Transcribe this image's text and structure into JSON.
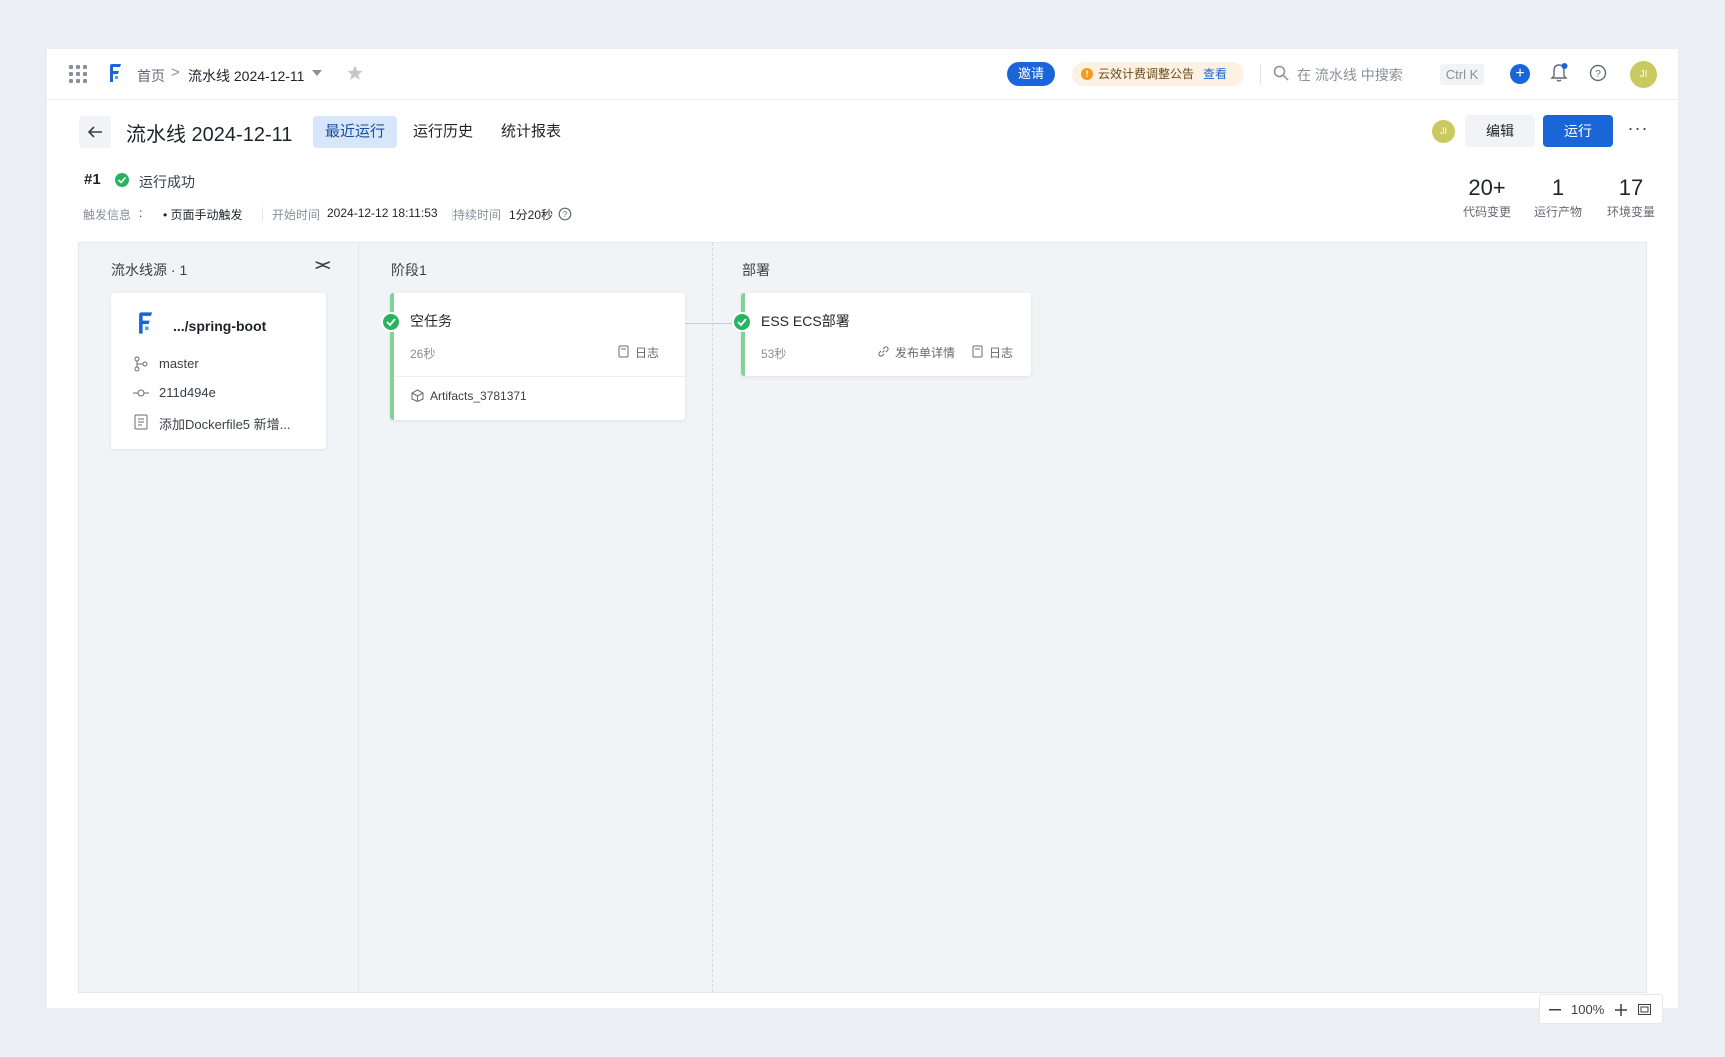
{
  "nav": {
    "breadcrumb_home": "首页",
    "breadcrumb_sep": ">",
    "pipeline_name": "流水线 2024-12-11",
    "invite_label": "邀请",
    "notice_text": "云效计费调整公告",
    "notice_link": "查看",
    "search_placeholder": "在 流水线 中搜索",
    "shortcut": "Ctrl K",
    "plus": "+",
    "avatar_initials": "JI"
  },
  "header": {
    "title": "流水线 2024-12-11",
    "tabs": [
      {
        "label": "最近运行"
      },
      {
        "label": "运行历史"
      },
      {
        "label": "统计报表"
      }
    ],
    "avatar_initials": "JI",
    "edit_label": "编辑",
    "run_label": "运行",
    "more_label": "···"
  },
  "run": {
    "number": "#1",
    "status": "运行成功",
    "trigger_label": "触发信息",
    "trigger_value": "• 页面手动触发",
    "start_label": "开始时间",
    "start_value": "2024-12-12 18:11:53",
    "duration_label": "持续时间",
    "duration_value": "1分20秒",
    "stats": [
      {
        "value": "20+",
        "label": "代码变更"
      },
      {
        "value": "1",
        "label": "运行产物"
      },
      {
        "value": "17",
        "label": "环境变量"
      }
    ]
  },
  "canvas": {
    "source_title": "流水线源 · 1",
    "collapse_icon": "><",
    "source": {
      "repo": ".../spring-boot",
      "branch": "master",
      "commit": "211d494e",
      "message": "添加Dockerfile5 新增..."
    },
    "stage1": {
      "title": "阶段1",
      "job_name": "空任务",
      "duration": "26秒",
      "log_label": "日志",
      "artifact": "Artifacts_3781371"
    },
    "stage2": {
      "title": "部署",
      "job_name": "ESS ECS部署",
      "duration": "53秒",
      "release_label": "发布单详情",
      "log_label": "日志"
    },
    "zoom": "100%"
  },
  "colors": {
    "primary": "#1a66d9",
    "success": "#27b35f",
    "success_bar": "#7ed49b",
    "notice_bg": "#fdf1e3",
    "avatar": "#c8c95f"
  }
}
